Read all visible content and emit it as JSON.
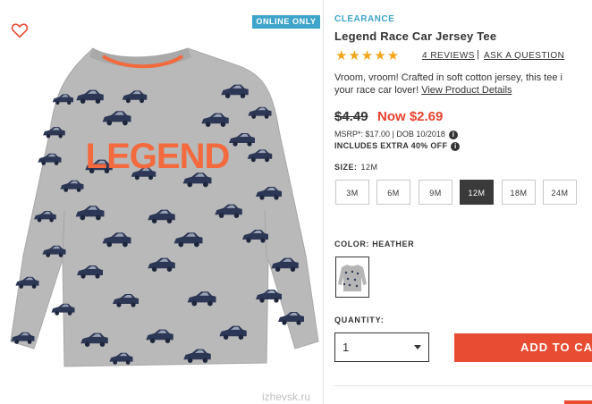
{
  "badge": "ONLINE ONLY",
  "watermark": "izhevsk.ru",
  "shirt": {
    "print_text": "LEGEND"
  },
  "product": {
    "category": "CLEARANCE",
    "title": "Legend Race Car Jersey Tee",
    "rating_stars": "★★★★★",
    "rating": 5,
    "reviews_link": "4 REVIEWS",
    "review_separator": "|",
    "ask_link": "ASK A QUESTION",
    "description": "Vroom, vroom! Crafted in soft cotton jersey, this tee i",
    "description_line2": "your race car lover!",
    "details_link": "View Product Details"
  },
  "price": {
    "old": "$4.49",
    "now": "Now $2.69",
    "msrp": "MSRP*: $17.00 | DOB 10/2018",
    "extra": "INCLUDES EXTRA 40% OFF",
    "info_glyph": "i"
  },
  "size": {
    "label": "SIZE:",
    "selected": "12M",
    "options": [
      "3M",
      "6M",
      "9M",
      "12M",
      "18M",
      "24M"
    ]
  },
  "color": {
    "label": "COLOR: HEATHER"
  },
  "quantity": {
    "label": "QUANTITY:",
    "value": "1"
  },
  "cart": {
    "add_label": "ADD TO CART"
  },
  "colors": {
    "accent_blue": "#3fa4c9",
    "sale_red": "#e8432e",
    "star": "#f2a71b",
    "button_red": "#e84c33"
  }
}
